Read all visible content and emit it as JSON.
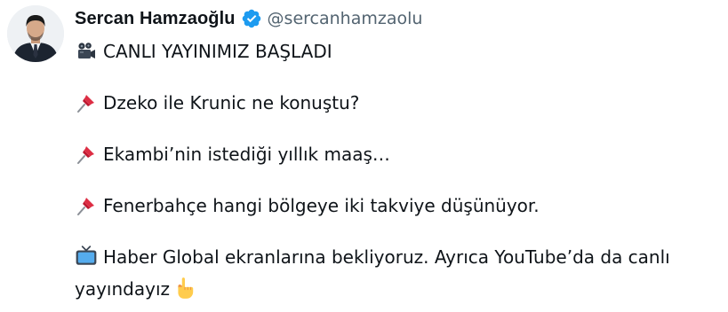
{
  "author": {
    "display_name": "Sercan Hamzaoğlu",
    "handle": "@sercanhamzaolu",
    "verified": true
  },
  "tweet": {
    "line1": "CANLI YAYINIMIZ BAŞLADI",
    "line2": "Dzeko ile Krunic ne konuştu?",
    "line3": "Ekambi’nin istediği yıllık maaş…",
    "line4": "Fenerbahçe hangi bölgeye iki takviye düşünüyor.",
    "line5": "Haber Global ekranlarına bekliyoruz. Ayrıca YouTube’da da canlı yayındayız"
  },
  "icons": {
    "line1": "movie-camera-icon",
    "pin": "pushpin-icon",
    "line5": "television-icon",
    "end": "pointing-down-icon"
  },
  "colors": {
    "text": "#0f1419",
    "handle": "#536471",
    "verified": "#1d9bf0"
  }
}
